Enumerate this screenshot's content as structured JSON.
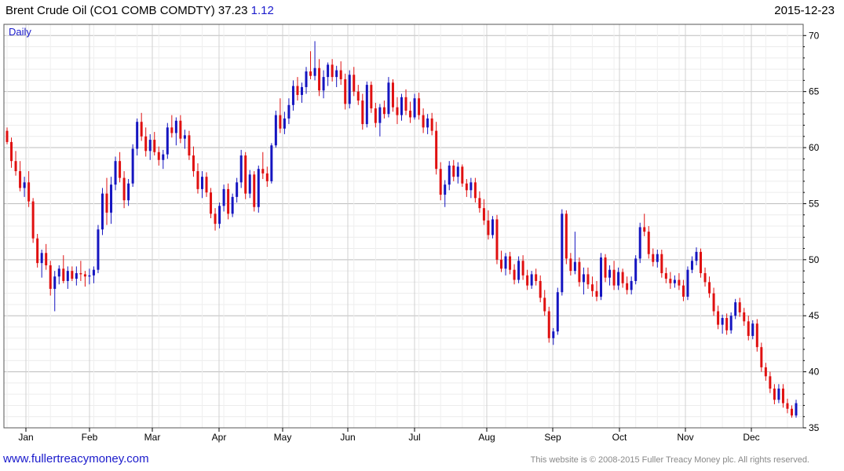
{
  "header": {
    "name": "Brent Crude Oil",
    "symbol": "(CO1 COMB COMDTY)",
    "last": "37.23",
    "change": "1.12",
    "date": "2015-12-23"
  },
  "interval_label": "Daily",
  "footer": {
    "link": "www.fullertreacymoney.com",
    "copyright": "This website is © 2008-2015 Fuller Treacy Money plc. All rights reserved."
  },
  "colors": {
    "up": "#1515c0",
    "down": "#e01010",
    "grid": "#dcdcdc",
    "frame": "#555555"
  },
  "chart_data": {
    "type": "candlestick",
    "y_axis": {
      "side": "right",
      "min": 35,
      "max": 71,
      "ticks": [
        35,
        40,
        45,
        50,
        55,
        60,
        65,
        70
      ]
    },
    "x_axis": {
      "labels": [
        "Jan",
        "Feb",
        "Mar",
        "Apr",
        "May",
        "Jun",
        "Jul",
        "Aug",
        "Sep",
        "Oct",
        "Nov",
        "Dec"
      ]
    },
    "grid": true,
    "ohlc": [
      [
        61.5,
        61.8,
        60.3,
        60.5
      ],
      [
        60.5,
        60.9,
        58.2,
        58.8
      ],
      [
        58.8,
        59.7,
        57.5,
        57.9
      ],
      [
        57.9,
        58.8,
        56.1,
        56.4
      ],
      [
        56.4,
        57.4,
        55.6,
        56.9
      ],
      [
        56.9,
        57.9,
        54.7,
        55.2
      ],
      [
        55.2,
        55.5,
        51.5,
        51.9
      ],
      [
        51.9,
        52.3,
        49.3,
        49.7
      ],
      [
        49.7,
        50.9,
        48.4,
        50.6
      ],
      [
        50.6,
        51.4,
        49.1,
        49.5
      ],
      [
        49.5,
        49.9,
        46.8,
        47.4
      ],
      [
        47.4,
        49.0,
        45.4,
        48.5
      ],
      [
        48.5,
        49.5,
        47.8,
        49.2
      ],
      [
        49.2,
        50.4,
        47.9,
        48.1
      ],
      [
        48.1,
        49.4,
        47.4,
        49.0
      ],
      [
        49.0,
        49.4,
        48.1,
        48.3
      ],
      [
        48.3,
        49.4,
        47.7,
        48.8
      ],
      [
        48.8,
        49.9,
        48.1,
        48.7
      ],
      [
        48.7,
        49.0,
        47.6,
        48.5
      ],
      [
        48.5,
        49.2,
        47.8,
        48.6
      ],
      [
        48.6,
        49.4,
        47.9,
        49.1
      ],
      [
        49.1,
        53.1,
        48.8,
        52.7
      ],
      [
        52.7,
        56.4,
        52.2,
        55.9
      ],
      [
        55.9,
        57.3,
        53.1,
        54.2
      ],
      [
        54.2,
        57.4,
        53.2,
        56.7
      ],
      [
        56.7,
        59.2,
        56.2,
        58.8
      ],
      [
        58.8,
        59.6,
        56.9,
        57.3
      ],
      [
        57.3,
        57.9,
        54.6,
        55.3
      ],
      [
        55.3,
        57.2,
        54.8,
        56.8
      ],
      [
        56.8,
        60.3,
        56.5,
        59.9
      ],
      [
        59.9,
        62.6,
        59.3,
        62.3
      ],
      [
        62.3,
        63.1,
        60.6,
        61.0
      ],
      [
        61.0,
        61.8,
        59.2,
        59.7
      ],
      [
        59.7,
        61.2,
        58.9,
        60.7
      ],
      [
        60.7,
        61.4,
        59.3,
        59.6
      ],
      [
        59.6,
        60.1,
        58.4,
        58.9
      ],
      [
        58.9,
        59.8,
        58.1,
        59.4
      ],
      [
        59.4,
        62.2,
        59.0,
        61.8
      ],
      [
        61.8,
        62.9,
        60.9,
        61.3
      ],
      [
        61.3,
        62.7,
        60.2,
        62.4
      ],
      [
        62.4,
        62.9,
        60.4,
        60.8
      ],
      [
        60.8,
        61.6,
        59.9,
        61.1
      ],
      [
        61.1,
        61.5,
        58.9,
        59.3
      ],
      [
        59.3,
        60.1,
        57.4,
        57.9
      ],
      [
        57.9,
        58.6,
        55.9,
        56.3
      ],
      [
        56.3,
        57.9,
        55.5,
        57.4
      ],
      [
        57.4,
        57.8,
        55.6,
        56.0
      ],
      [
        56.0,
        56.4,
        53.7,
        54.1
      ],
      [
        54.1,
        54.6,
        52.6,
        53.2
      ],
      [
        53.2,
        55.1,
        52.8,
        54.8
      ],
      [
        54.8,
        56.7,
        54.3,
        56.3
      ],
      [
        56.3,
        56.8,
        53.6,
        54.1
      ],
      [
        54.1,
        55.9,
        53.8,
        55.6
      ],
      [
        55.6,
        57.3,
        55.1,
        56.9
      ],
      [
        56.9,
        59.8,
        56.4,
        59.3
      ],
      [
        59.3,
        59.6,
        55.4,
        55.9
      ],
      [
        55.9,
        58.0,
        55.5,
        57.6
      ],
      [
        57.6,
        57.9,
        54.3,
        54.7
      ],
      [
        54.7,
        58.4,
        54.2,
        58.1
      ],
      [
        58.1,
        59.6,
        57.2,
        57.7
      ],
      [
        57.7,
        58.3,
        56.5,
        57.0
      ],
      [
        57.0,
        60.4,
        56.8,
        60.2
      ],
      [
        60.2,
        63.3,
        60.0,
        62.9
      ],
      [
        62.9,
        64.4,
        61.3,
        61.7
      ],
      [
        61.7,
        63.2,
        61.2,
        62.6
      ],
      [
        62.6,
        64.4,
        62.1,
        63.8
      ],
      [
        63.8,
        66.0,
        63.3,
        65.5
      ],
      [
        65.5,
        66.3,
        64.2,
        64.7
      ],
      [
        64.7,
        65.8,
        64.0,
        65.4
      ],
      [
        65.4,
        67.2,
        64.8,
        66.8
      ],
      [
        66.8,
        68.6,
        66.1,
        66.4
      ],
      [
        66.4,
        69.5,
        66.0,
        67.1
      ],
      [
        67.1,
        67.9,
        64.6,
        65.1
      ],
      [
        65.1,
        66.9,
        64.4,
        66.3
      ],
      [
        66.3,
        67.6,
        65.5,
        67.4
      ],
      [
        67.4,
        67.9,
        65.9,
        66.3
      ],
      [
        66.3,
        67.3,
        65.4,
        66.9
      ],
      [
        66.9,
        67.7,
        65.6,
        66.1
      ],
      [
        66.1,
        66.6,
        63.4,
        63.9
      ],
      [
        63.9,
        66.9,
        63.5,
        66.5
      ],
      [
        66.5,
        67.2,
        64.6,
        65.0
      ],
      [
        65.0,
        65.6,
        63.8,
        64.2
      ],
      [
        64.2,
        64.8,
        61.6,
        62.1
      ],
      [
        62.1,
        65.9,
        61.8,
        65.6
      ],
      [
        65.6,
        65.9,
        63.1,
        63.5
      ],
      [
        63.5,
        64.0,
        61.8,
        62.2
      ],
      [
        62.2,
        63.9,
        61.0,
        63.6
      ],
      [
        63.6,
        64.2,
        62.6,
        63.0
      ],
      [
        63.0,
        66.3,
        62.7,
        65.8
      ],
      [
        65.8,
        66.1,
        63.2,
        63.6
      ],
      [
        63.6,
        64.5,
        62.1,
        62.9
      ],
      [
        62.9,
        64.8,
        62.4,
        64.5
      ],
      [
        64.5,
        65.2,
        62.9,
        63.3
      ],
      [
        63.3,
        64.1,
        62.2,
        62.7
      ],
      [
        62.7,
        64.8,
        62.5,
        64.4
      ],
      [
        64.4,
        64.9,
        62.5,
        62.9
      ],
      [
        62.9,
        63.5,
        61.3,
        61.8
      ],
      [
        61.8,
        63.0,
        61.2,
        62.6
      ],
      [
        62.6,
        63.1,
        61.1,
        61.5
      ],
      [
        61.5,
        62.3,
        57.6,
        58.1
      ],
      [
        58.1,
        58.7,
        55.3,
        55.8
      ],
      [
        55.8,
        57.1,
        54.7,
        56.7
      ],
      [
        56.7,
        58.8,
        56.2,
        58.4
      ],
      [
        58.4,
        58.9,
        57.0,
        57.4
      ],
      [
        57.4,
        58.7,
        56.8,
        58.3
      ],
      [
        58.3,
        58.5,
        56.5,
        56.8
      ],
      [
        56.8,
        57.2,
        55.6,
        56.2
      ],
      [
        56.2,
        57.3,
        55.5,
        56.9
      ],
      [
        56.9,
        57.3,
        55.1,
        55.5
      ],
      [
        55.5,
        56.1,
        54.2,
        54.6
      ],
      [
        54.6,
        55.4,
        53.1,
        53.5
      ],
      [
        53.5,
        54.4,
        51.8,
        52.2
      ],
      [
        52.2,
        53.9,
        51.9,
        53.6
      ],
      [
        53.6,
        54.0,
        49.6,
        50.0
      ],
      [
        50.0,
        50.8,
        48.9,
        49.2
      ],
      [
        49.2,
        50.6,
        48.6,
        50.3
      ],
      [
        50.3,
        50.7,
        48.7,
        49.1
      ],
      [
        49.1,
        49.6,
        47.8,
        48.2
      ],
      [
        48.2,
        50.3,
        47.9,
        49.9
      ],
      [
        49.9,
        50.4,
        48.2,
        48.6
      ],
      [
        48.6,
        49.1,
        47.3,
        47.7
      ],
      [
        47.7,
        49.0,
        47.4,
        48.7
      ],
      [
        48.7,
        49.2,
        47.7,
        48.1
      ],
      [
        48.1,
        48.6,
        46.2,
        46.6
      ],
      [
        46.6,
        47.3,
        45.0,
        45.4
      ],
      [
        45.4,
        45.8,
        42.6,
        43.0
      ],
      [
        43.0,
        43.9,
        42.4,
        43.6
      ],
      [
        43.6,
        47.5,
        43.3,
        47.1
      ],
      [
        47.1,
        54.5,
        46.8,
        54.1
      ],
      [
        54.1,
        54.4,
        49.6,
        50.1
      ],
      [
        50.1,
        50.6,
        48.6,
        49.0
      ],
      [
        49.0,
        52.5,
        48.7,
        49.8
      ],
      [
        49.8,
        50.2,
        47.6,
        48.0
      ],
      [
        48.0,
        49.3,
        46.9,
        48.7
      ],
      [
        48.7,
        49.3,
        47.4,
        47.8
      ],
      [
        47.8,
        48.5,
        46.7,
        47.2
      ],
      [
        47.2,
        48.1,
        46.3,
        46.7
      ],
      [
        46.7,
        50.6,
        46.4,
        50.2
      ],
      [
        50.2,
        50.5,
        48.0,
        48.4
      ],
      [
        48.4,
        49.5,
        47.7,
        49.1
      ],
      [
        49.1,
        49.9,
        47.3,
        47.7
      ],
      [
        47.7,
        49.3,
        47.3,
        48.9
      ],
      [
        48.9,
        49.2,
        47.5,
        47.9
      ],
      [
        47.9,
        48.5,
        46.9,
        47.3
      ],
      [
        47.3,
        48.5,
        46.9,
        48.1
      ],
      [
        48.1,
        50.4,
        47.8,
        50.1
      ],
      [
        50.1,
        53.3,
        49.7,
        52.9
      ],
      [
        52.9,
        54.1,
        52.1,
        52.5
      ],
      [
        52.5,
        53.0,
        50.1,
        50.5
      ],
      [
        50.5,
        51.0,
        49.4,
        49.8
      ],
      [
        49.8,
        50.9,
        49.3,
        50.5
      ],
      [
        50.5,
        50.9,
        48.4,
        48.8
      ],
      [
        48.8,
        49.3,
        47.9,
        48.3
      ],
      [
        48.3,
        48.9,
        47.4,
        47.9
      ],
      [
        47.9,
        48.6,
        47.5,
        48.2
      ],
      [
        48.2,
        48.8,
        47.3,
        47.7
      ],
      [
        47.7,
        48.2,
        46.3,
        46.7
      ],
      [
        46.7,
        49.4,
        46.4,
        49.1
      ],
      [
        49.1,
        50.3,
        48.8,
        49.9
      ],
      [
        49.9,
        51.1,
        49.5,
        50.7
      ],
      [
        50.7,
        51.0,
        48.4,
        48.8
      ],
      [
        48.8,
        49.3,
        47.6,
        48.0
      ],
      [
        48.0,
        48.5,
        46.6,
        47.0
      ],
      [
        47.0,
        47.5,
        45.0,
        45.4
      ],
      [
        45.4,
        45.9,
        43.8,
        44.2
      ],
      [
        44.2,
        45.1,
        43.4,
        44.8
      ],
      [
        44.8,
        45.2,
        43.3,
        43.7
      ],
      [
        43.7,
        45.3,
        43.4,
        45.0
      ],
      [
        45.0,
        46.5,
        44.7,
        46.2
      ],
      [
        46.2,
        46.6,
        44.9,
        45.3
      ],
      [
        45.3,
        45.7,
        44.1,
        44.5
      ],
      [
        44.5,
        45.0,
        42.8,
        43.2
      ],
      [
        43.2,
        44.6,
        42.9,
        44.3
      ],
      [
        44.3,
        44.7,
        41.8,
        42.2
      ],
      [
        42.2,
        42.6,
        40.0,
        40.4
      ],
      [
        40.4,
        40.8,
        39.2,
        39.6
      ],
      [
        39.6,
        40.0,
        38.1,
        38.5
      ],
      [
        38.5,
        38.9,
        37.1,
        37.5
      ],
      [
        37.5,
        38.9,
        37.2,
        38.5
      ],
      [
        38.5,
        38.9,
        36.8,
        37.2
      ],
      [
        37.2,
        37.6,
        36.3,
        36.7
      ],
      [
        36.7,
        37.0,
        35.9,
        36.1
      ],
      [
        36.1,
        37.5,
        35.9,
        37.2
      ]
    ]
  }
}
